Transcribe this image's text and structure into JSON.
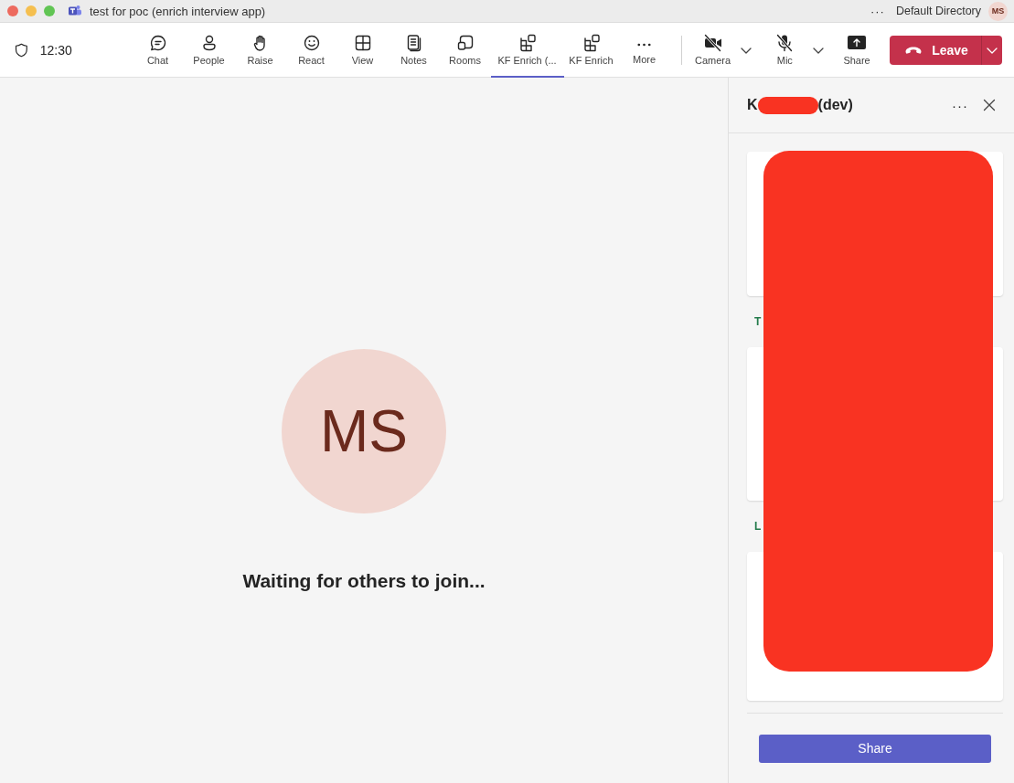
{
  "title_bar": {
    "title": "test for poc (enrich interview app)",
    "more": "···",
    "directory": "Default Directory",
    "avatar": "MS"
  },
  "toolbar": {
    "time": "12:30",
    "items": [
      {
        "label": "Chat",
        "kind": "chat",
        "selected": false
      },
      {
        "label": "People",
        "kind": "people",
        "selected": false
      },
      {
        "label": "Raise",
        "kind": "hand",
        "selected": false
      },
      {
        "label": "React",
        "kind": "smile",
        "selected": false
      },
      {
        "label": "View",
        "kind": "grid",
        "selected": false
      },
      {
        "label": "Notes",
        "kind": "notes",
        "selected": false
      },
      {
        "label": "Rooms",
        "kind": "rooms",
        "selected": false
      },
      {
        "label": "KF Enrich (...",
        "kind": "apps",
        "selected": true
      },
      {
        "label": "KF Enrich",
        "kind": "apps",
        "selected": false
      },
      {
        "label": "More",
        "kind": "dots",
        "selected": false
      }
    ],
    "camera": {
      "label": "Camera",
      "on": false
    },
    "mic": {
      "label": "Mic",
      "on": false
    },
    "share": {
      "label": "Share"
    },
    "leave": {
      "label": "Leave"
    }
  },
  "stage": {
    "avatar": "MS",
    "message": "Waiting for others to join..."
  },
  "panel": {
    "title_start": "K",
    "title_end": "(dev)",
    "more": "···",
    "redacted": true,
    "sections": [
      "T",
      "L"
    ],
    "share_button": "Share"
  }
}
